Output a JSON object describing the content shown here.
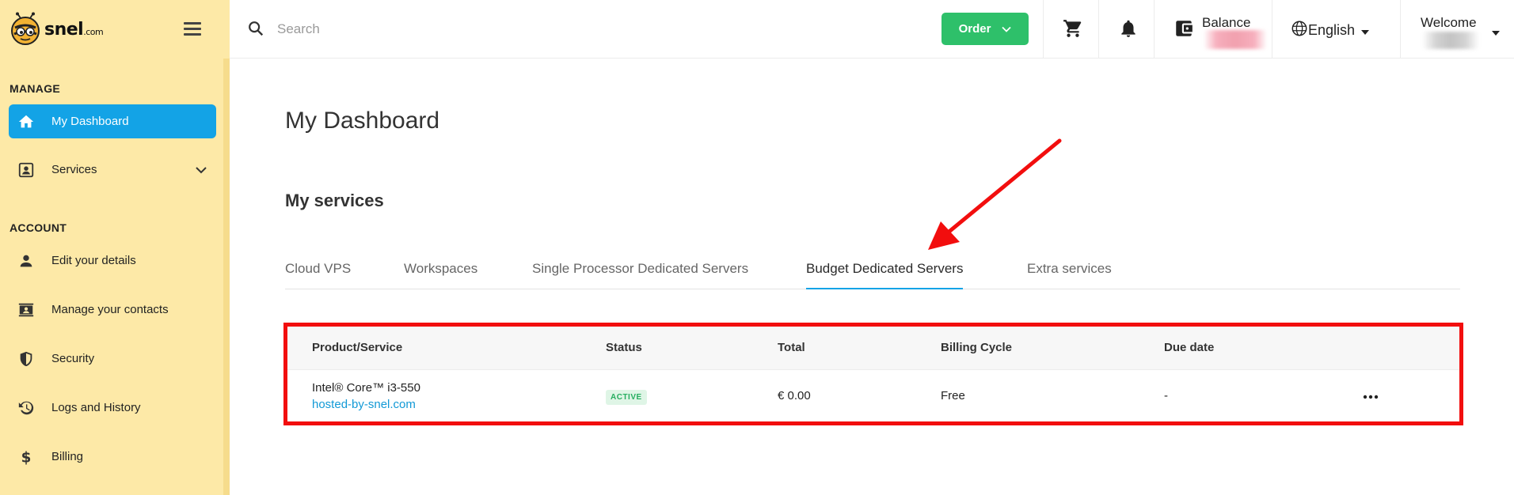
{
  "brand": {
    "name": "snel",
    "suffix": ".com"
  },
  "search": {
    "placeholder": "Search",
    "value": ""
  },
  "header": {
    "order_label": "Order",
    "balance_label": "Balance",
    "language": "English",
    "welcome_label": "Welcome"
  },
  "sidebar": {
    "manage_heading": "MANAGE",
    "account_heading": "ACCOUNT",
    "items": [
      {
        "label": "My Dashboard",
        "icon": "home-icon",
        "active": true
      },
      {
        "label": "Services",
        "icon": "contact-card-icon",
        "has_chevron": true
      },
      {
        "label": "Edit your details",
        "icon": "person-icon"
      },
      {
        "label": "Manage your contacts",
        "icon": "contacts-book-icon"
      },
      {
        "label": "Security",
        "icon": "shield-icon"
      },
      {
        "label": "Logs and History",
        "icon": "history-icon"
      },
      {
        "label": "Billing",
        "icon": "dollar-icon"
      }
    ]
  },
  "main": {
    "page_title": "My Dashboard",
    "section_title": "My services",
    "tabs": [
      {
        "label": "Cloud VPS"
      },
      {
        "label": "Workspaces"
      },
      {
        "label": "Single Processor Dedicated Servers"
      },
      {
        "label": "Budget Dedicated Servers",
        "active": true
      },
      {
        "label": "Extra services"
      }
    ],
    "table": {
      "columns": [
        "Product/Service",
        "Status",
        "Total",
        "Billing Cycle",
        "Due date"
      ],
      "rows": [
        {
          "product": "Intel® Core™ i3-550",
          "domain": "hosted-by-snel.com",
          "status": "ACTIVE",
          "total": "€ 0.00",
          "billing_cycle": "Free",
          "due_date": "-"
        }
      ]
    }
  },
  "colors": {
    "sidebar_bg": "#fde9a7",
    "accent_blue": "#13a3e6",
    "order_green": "#2ec06a",
    "annotation_red": "#f20e0e",
    "status_green": "#27ae60"
  }
}
